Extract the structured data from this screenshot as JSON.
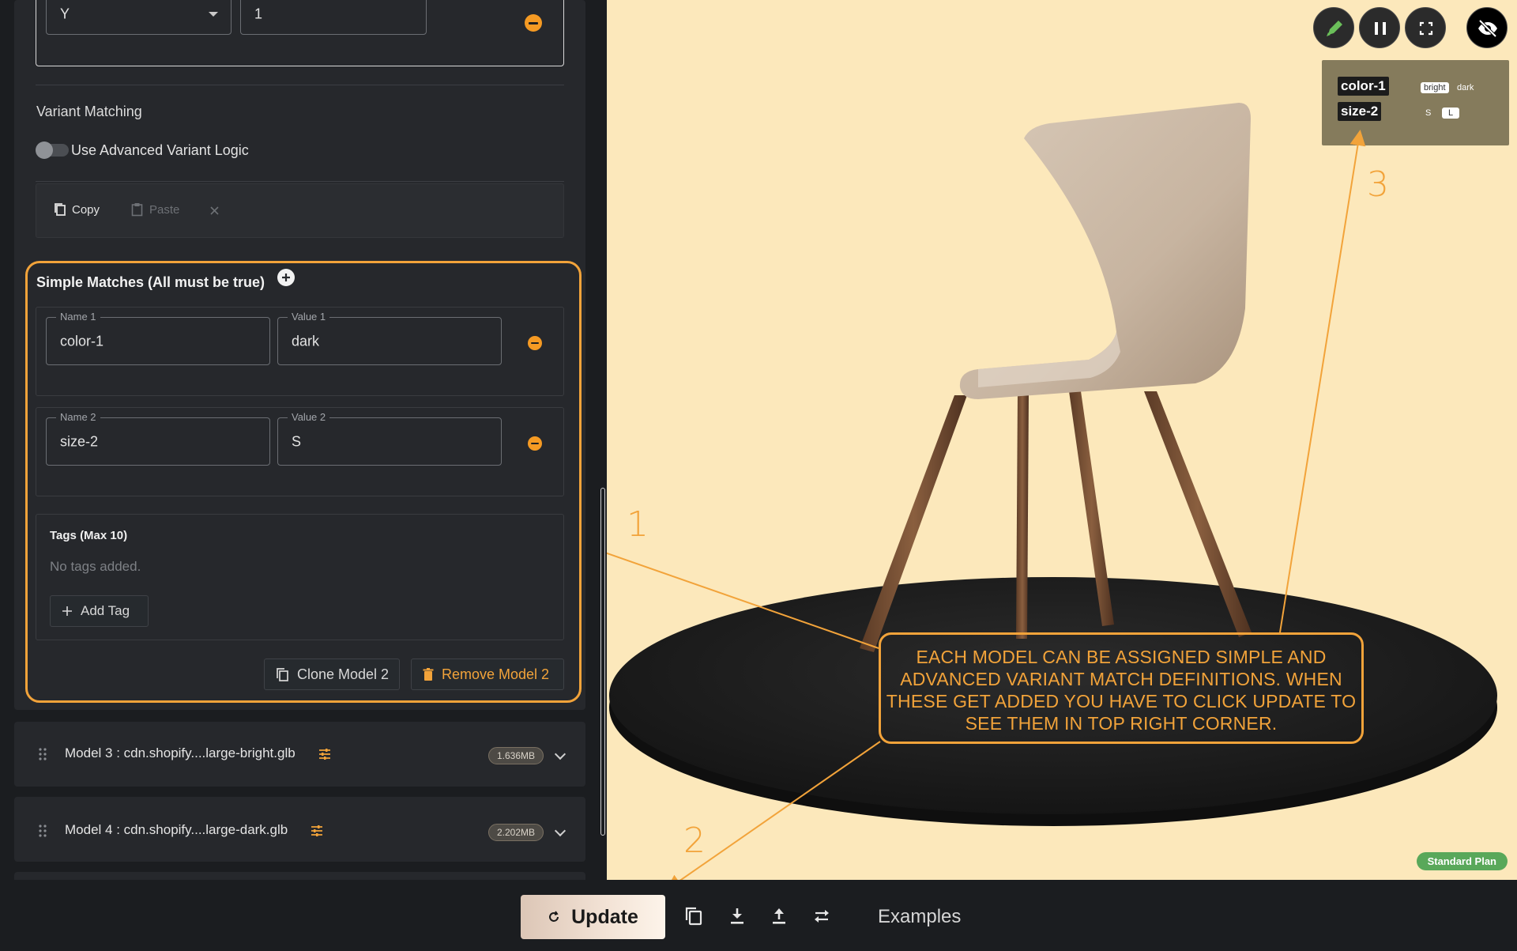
{
  "top_row": {
    "axis_value": "Y",
    "number_value": "1"
  },
  "variant_matching": {
    "heading": "Variant Matching",
    "toggle_label": "Use Advanced Variant Logic",
    "copy_label": "Copy",
    "paste_label": "Paste"
  },
  "simple_matches": {
    "heading": "Simple Matches (All must be true)",
    "rows": [
      {
        "name_legend": "Name 1",
        "name_value": "color-1",
        "value_legend": "Value 1",
        "value_value": "dark"
      },
      {
        "name_legend": "Name 2",
        "name_value": "size-2",
        "value_legend": "Value 2",
        "value_value": "S"
      }
    ]
  },
  "tags": {
    "heading": "Tags (Max 10)",
    "empty_text": "No tags added.",
    "add_label": "Add Tag"
  },
  "model_actions": {
    "clone_label": "Clone Model 2",
    "remove_label": "Remove Model 2"
  },
  "models": [
    {
      "title": "Model 3 : cdn.shopify....large-bright.glb",
      "size": "1.636MB"
    },
    {
      "title": "Model 4 : cdn.shopify....large-dark.glb",
      "size": "2.202MB"
    }
  ],
  "viewer": {
    "variants": [
      {
        "name": "color-1",
        "options": [
          "bright",
          "dark"
        ],
        "selected": "bright"
      },
      {
        "name": "size-2",
        "options": [
          "S",
          "L"
        ],
        "selected": "L"
      }
    ],
    "plan_badge": "Standard Plan",
    "callout_text": "EACH MODEL CAN BE ASSIGNED SIMPLE AND ADVANCED VARIANT MATCH DEFINITIONS. WHEN THESE GET ADDED YOU HAVE TO CLICK UPDATE TO SEE THEM IN TOP RIGHT CORNER.",
    "annotation_numbers": [
      "1",
      "2",
      "3"
    ],
    "colors": {
      "accent": "#f2a33a",
      "background": "#fce8bb",
      "edit": "#6bbf5a",
      "plan": "#59a85a"
    }
  },
  "bottom_bar": {
    "update_label": "Update",
    "examples_label": "Examples"
  },
  "icons": [
    "pencil-icon",
    "pause-icon",
    "fullscreen-icon",
    "eye-off-icon",
    "copy-icon",
    "paste-icon",
    "close-icon",
    "plus-icon",
    "drag-handle-icon",
    "tune-icon",
    "refresh-icon",
    "download-icon",
    "upload-icon",
    "swap-icon",
    "trash-icon"
  ]
}
